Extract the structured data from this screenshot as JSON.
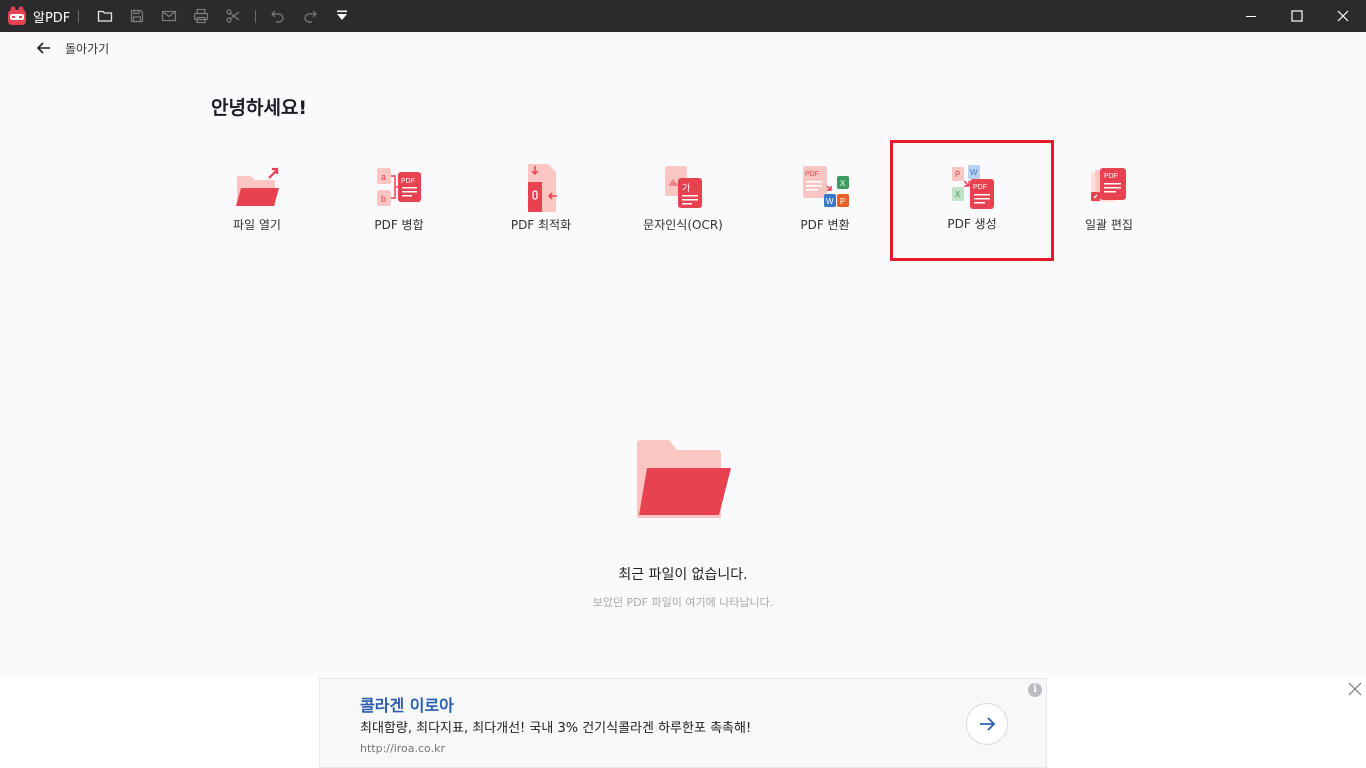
{
  "app": {
    "name": "알PDF"
  },
  "back": {
    "label": "돌아가기"
  },
  "greeting": "안녕하세요!",
  "tools": [
    {
      "id": "open",
      "label": "파일 열기",
      "icon": "open-file-icon"
    },
    {
      "id": "merge",
      "label": "PDF 병합",
      "icon": "merge-pdf-icon"
    },
    {
      "id": "optimize",
      "label": "PDF 최적화",
      "icon": "optimize-pdf-icon"
    },
    {
      "id": "ocr",
      "label": "문자인식(OCR)",
      "icon": "ocr-icon"
    },
    {
      "id": "convert",
      "label": "PDF 변환",
      "icon": "convert-pdf-icon"
    },
    {
      "id": "create",
      "label": "PDF 생성",
      "icon": "create-pdf-icon",
      "selected": true
    },
    {
      "id": "batch",
      "label": "일괄 편집",
      "icon": "batch-edit-icon"
    }
  ],
  "empty": {
    "title": "최근 파일이 없습니다.",
    "subtitle": "보았던 PDF 파일이 여기에 나타납니다."
  },
  "ad": {
    "title": "콜라겐 이로아",
    "description": "최대함량, 최다지표, 최다개선! 국내 3% 건기식콜라겐 하루한포 촉촉해!",
    "url": "http://iroa.co.kr",
    "info_glyph": "i"
  },
  "colors": {
    "accent": "#e8414f",
    "light_accent": "#fbc6c2",
    "selection": "#e21b2a",
    "titlebar": "#2b2b2e"
  }
}
